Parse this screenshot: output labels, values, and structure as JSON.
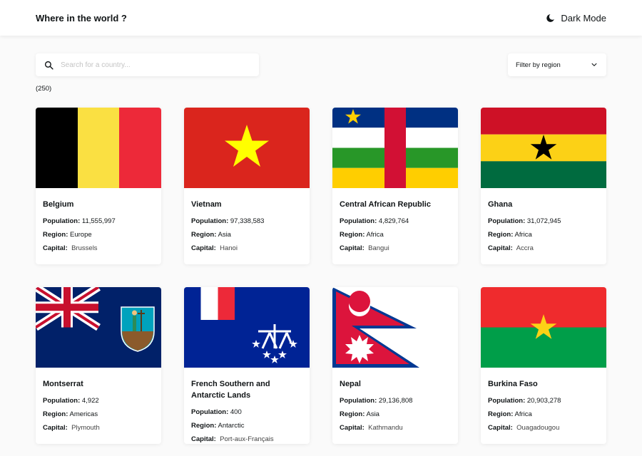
{
  "header": {
    "title": "Where in the world ?",
    "dark_mode_label": "Dark Mode"
  },
  "search": {
    "placeholder": "Search for a country..."
  },
  "filter": {
    "label": "Filter by region"
  },
  "result_count": "(250)",
  "labels": {
    "population": "Population:",
    "region": "Region:",
    "capital": "Capital:"
  },
  "countries": [
    {
      "name": "Belgium",
      "population": "11,555,997",
      "region": "Europe",
      "capital": "Brussels"
    },
    {
      "name": "Vietnam",
      "population": "97,338,583",
      "region": "Asia",
      "capital": "Hanoi"
    },
    {
      "name": "Central African Republic",
      "population": "4,829,764",
      "region": "Africa",
      "capital": "Bangui"
    },
    {
      "name": "Ghana",
      "population": "31,072,945",
      "region": "Africa",
      "capital": "Accra"
    },
    {
      "name": "Montserrat",
      "population": "4,922",
      "region": "Americas",
      "capital": "Plymouth"
    },
    {
      "name": "French Southern and Antarctic Lands",
      "population": "400",
      "region": "Antarctic",
      "capital": "Port-aux-Français"
    },
    {
      "name": "Nepal",
      "population": "29,136,808",
      "region": "Asia",
      "capital": "Kathmandu"
    },
    {
      "name": "Burkina Faso",
      "population": "20,903,278",
      "region": "Africa",
      "capital": "Ouagadougou"
    }
  ],
  "colors": {
    "background": "#fafafa",
    "card": "#ffffff",
    "text": "#111517",
    "placeholder": "#c4c4c4"
  },
  "icons": {
    "search": "search-icon",
    "dark_mode": "moon-icon",
    "filter": "chevron-down-icon"
  }
}
